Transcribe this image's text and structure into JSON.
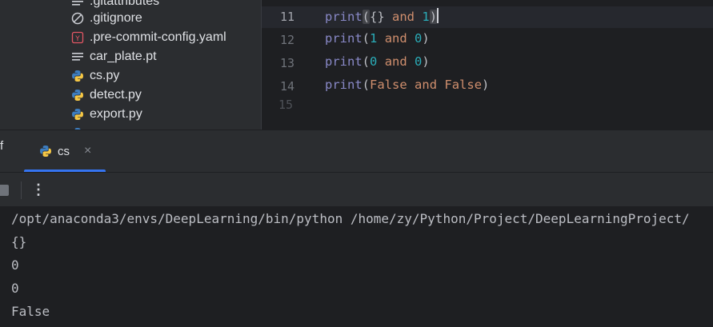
{
  "project_tree": {
    "items": [
      {
        "label": ".gitattributes",
        "icon": "text-file-icon"
      },
      {
        "label": ".gitignore",
        "icon": "ignore-file-icon"
      },
      {
        "label": ".pre-commit-config.yaml",
        "icon": "yaml-file-icon"
      },
      {
        "label": "car_plate.pt",
        "icon": "text-file-icon"
      },
      {
        "label": "cs.py",
        "icon": "python-file-icon"
      },
      {
        "label": "detect.py",
        "icon": "python-file-icon"
      },
      {
        "label": "export.py",
        "icon": "python-file-icon"
      }
    ]
  },
  "editor": {
    "lines": [
      {
        "number": "11",
        "code": "print({} and 1)"
      },
      {
        "number": "12",
        "code": "print(1 and 0)"
      },
      {
        "number": "13",
        "code": "print(0 and 0)"
      },
      {
        "number": "14",
        "code": "print(False and False)"
      }
    ],
    "partial_line_number": "15"
  },
  "run_panel": {
    "left_cut_label": "f",
    "tab_label": "cs",
    "tab_close": "×",
    "more_icon": "⋮",
    "console_lines": [
      "/opt/anaconda3/envs/DeepLearning/bin/python /home/zy/Python/Project/DeepLearningProject/",
      "{}",
      "0",
      "0",
      "False"
    ]
  },
  "colors": {
    "accent": "#3574f0",
    "keyword": "#cf8e6d",
    "builtin": "#8888c6",
    "number": "#2aacb8"
  }
}
